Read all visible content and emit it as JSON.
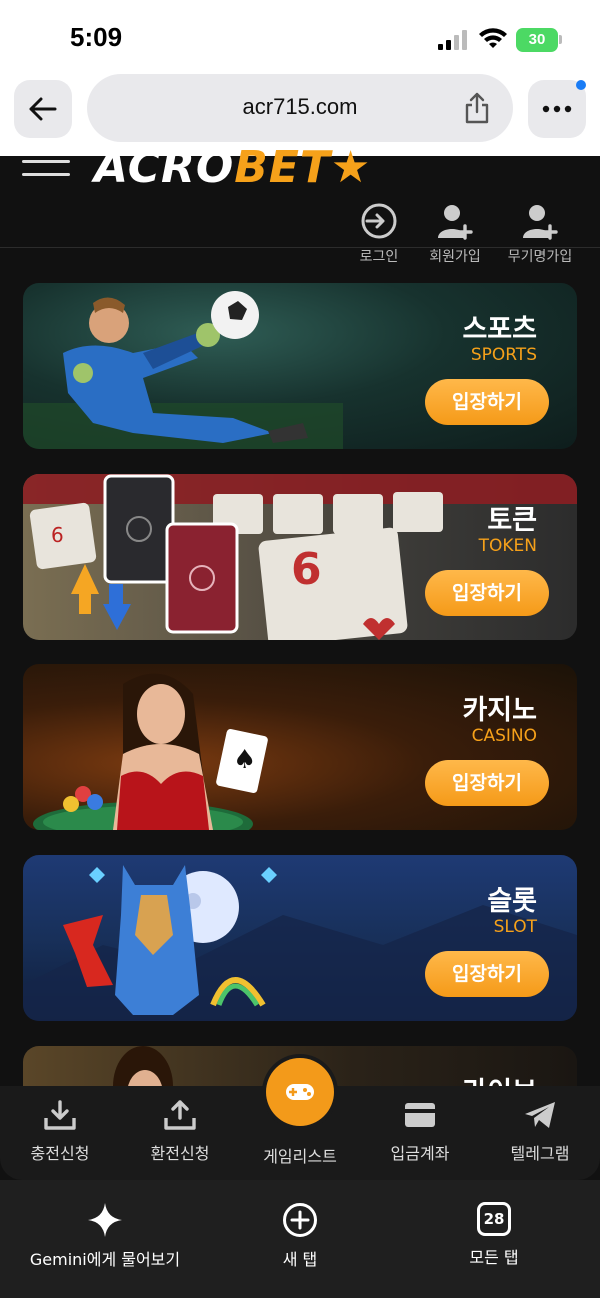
{
  "status_bar": {
    "time": "5:09",
    "battery": "30"
  },
  "browser": {
    "url": "acr715.com"
  },
  "site": {
    "logo_part1": "ACRO",
    "logo_part2": "BET★",
    "header_actions": [
      {
        "label": "로그인",
        "icon": "login-icon"
      },
      {
        "label": "회원가입",
        "icon": "user-add-icon"
      },
      {
        "label": "무기명가입",
        "icon": "user-add-icon"
      }
    ]
  },
  "cards": [
    {
      "title": "스포츠",
      "subtitle": "SPORTS",
      "button": "입장하기"
    },
    {
      "title": "토큰",
      "subtitle": "TOKEN",
      "button": "입장하기"
    },
    {
      "title": "카지노",
      "subtitle": "CASINO",
      "button": "입장하기"
    },
    {
      "title": "슬롯",
      "subtitle": "SLOT",
      "button": "입장하기"
    },
    {
      "title": "라이브",
      "subtitle": "",
      "button": ""
    }
  ],
  "bottom_nav": [
    {
      "label": "충전신청",
      "icon": "download-icon"
    },
    {
      "label": "환전신청",
      "icon": "upload-icon"
    },
    {
      "label": "게임리스트",
      "icon": "gamepad-icon"
    },
    {
      "label": "입금계좌",
      "icon": "card-icon"
    },
    {
      "label": "텔레그램",
      "icon": "telegram-icon"
    }
  ],
  "browser_bottom": [
    {
      "label": "Gemini에게 물어보기",
      "icon": "sparkle-icon"
    },
    {
      "label": "새 탭",
      "icon": "plus-circle-icon"
    },
    {
      "label": "모든 탭",
      "icon": "tabs-icon",
      "count": "28"
    }
  ],
  "colors": {
    "accent": "#f6a11a",
    "button": "#f59a18",
    "background": "#111111"
  }
}
